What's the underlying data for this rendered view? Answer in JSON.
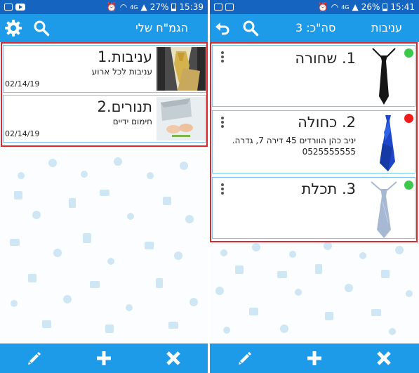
{
  "left_screen": {
    "status": {
      "battery": "27%",
      "time": "15:39",
      "network": "4G"
    },
    "appbar": {
      "title": "הגמ\"ח שלי"
    },
    "items": [
      {
        "title": "1.עניבות",
        "subtitle": "עניבות לכל ארוע",
        "date": "02/14/19"
      },
      {
        "title": "2.תנורים",
        "subtitle": "חימום ידיים",
        "date": "02/14/19"
      }
    ],
    "bottom_icons": [
      "pencil-icon",
      "plus-icon",
      "close-icon"
    ]
  },
  "right_screen": {
    "status": {
      "battery": "26%",
      "time": "15:41",
      "network": "4G"
    },
    "appbar": {
      "title": "עניבות",
      "count_label": "סה\"כ: 3"
    },
    "items": [
      {
        "title": "1. שחורה",
        "note": "",
        "status_color": "#3cc84a",
        "tie_color": "#151515"
      },
      {
        "title": "2. כחולה",
        "note": "יניב כהן הוורדים 45 דירה 7, גדרה. 0525555555",
        "status_color": "#f01b1b",
        "tie_color": "#1d47c8"
      },
      {
        "title": "3. תכלת",
        "note": "",
        "status_color": "#3cc84a",
        "tie_color": "#a7b8d2"
      }
    ],
    "bottom_icons": [
      "pencil-icon",
      "plus-icon",
      "close-icon"
    ]
  },
  "colors": {
    "status_bar": "#1565c0",
    "app_bar": "#1e9be8",
    "highlight_border": "#e0272d",
    "card_border": "#7ec6e8"
  }
}
